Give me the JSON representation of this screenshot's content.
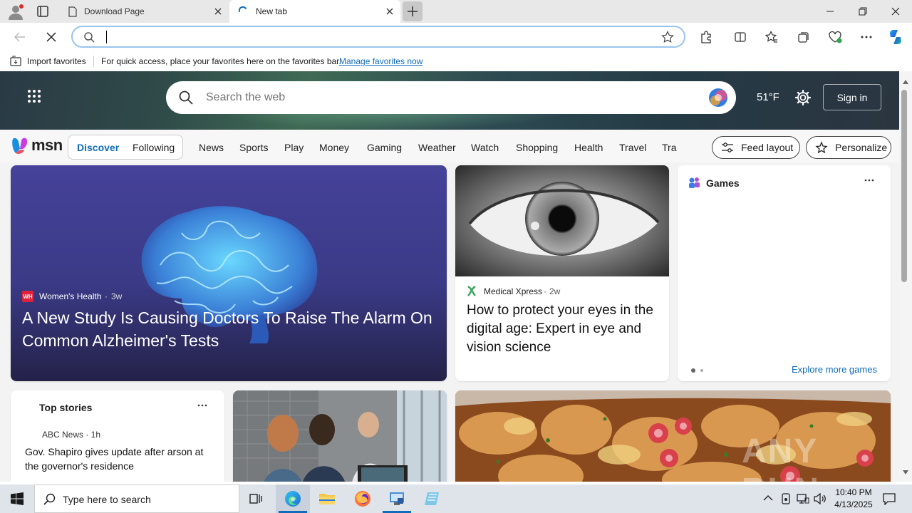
{
  "browser": {
    "tabs": [
      {
        "label": "Download Page"
      },
      {
        "label": "New tab"
      }
    ],
    "address": {
      "value": "",
      "placeholder": ""
    },
    "favorites_bar": {
      "import_label": "Import favorites",
      "hint": "For quick access, place your favorites here on the favorites bar.",
      "manage_link": "Manage favorites now"
    }
  },
  "msn": {
    "search_placeholder": "Search the web",
    "weather": "51°F",
    "signin": "Sign in",
    "logo": "msn",
    "toggle": [
      "Discover",
      "Following"
    ],
    "nav": [
      "News",
      "Sports",
      "Play",
      "Money",
      "Gaming",
      "Weather",
      "Watch",
      "Shopping",
      "Health",
      "Travel",
      "Trai"
    ],
    "feed_layout": "Feed layout",
    "personalize": "Personalize",
    "hero_card": {
      "source": "Women's Health",
      "age": "3w",
      "title": "A New Study Is Causing Doctors To Raise The Alarm On Common Alzheimer's Tests"
    },
    "eye_card": {
      "source": "Medical Xpress",
      "age": "2w",
      "title": "How to protect your eyes in the digital age: Expert in eye and vision science"
    },
    "games_card": {
      "title": "Games",
      "more": "Explore more games"
    },
    "top_stories": {
      "title": "Top stories",
      "source": "ABC News · 1h",
      "headline": "Gov. Shapiro gives update after arson at the governor's residence"
    },
    "watermark": "ANY RUN"
  },
  "taskbar": {
    "search_placeholder": "Type here to search",
    "time": "10:40 PM",
    "date": "4/13/2025"
  },
  "colors": {
    "accent": "#0f6cbd",
    "hero_bg": "#3d3a8f",
    "taskbar": "#dfe4ea"
  }
}
